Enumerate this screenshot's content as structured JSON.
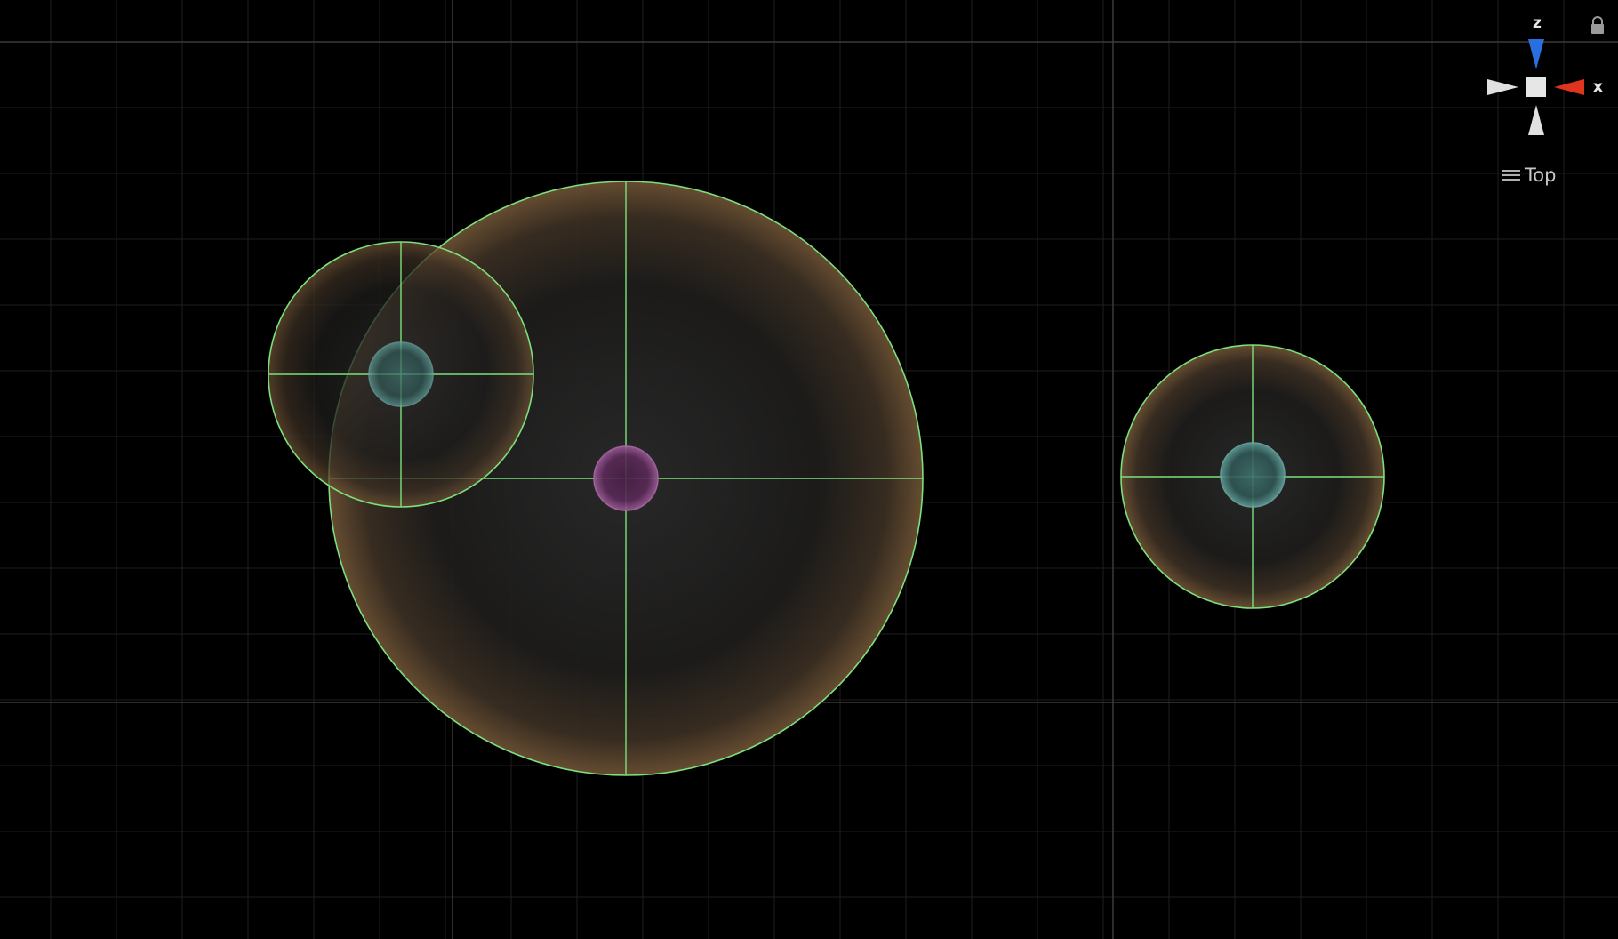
{
  "scene_view": {
    "projection": "Top",
    "gizmo": {
      "axis_z_label": "z",
      "axis_x_label": "x"
    },
    "icons": {
      "lock": "lock-icon",
      "menu": "hamburger-menu-icon"
    },
    "colors": {
      "background": "#000000",
      "collider_outline": "#7de07a",
      "sphere_fill_edge": "#a07850",
      "axis_z": "#2a6fe0",
      "axis_x": "#e0341e",
      "axis_neutral": "#e0e0e0",
      "center_teal": "#4fa3a0",
      "center_magenta": "#a040a0"
    }
  }
}
